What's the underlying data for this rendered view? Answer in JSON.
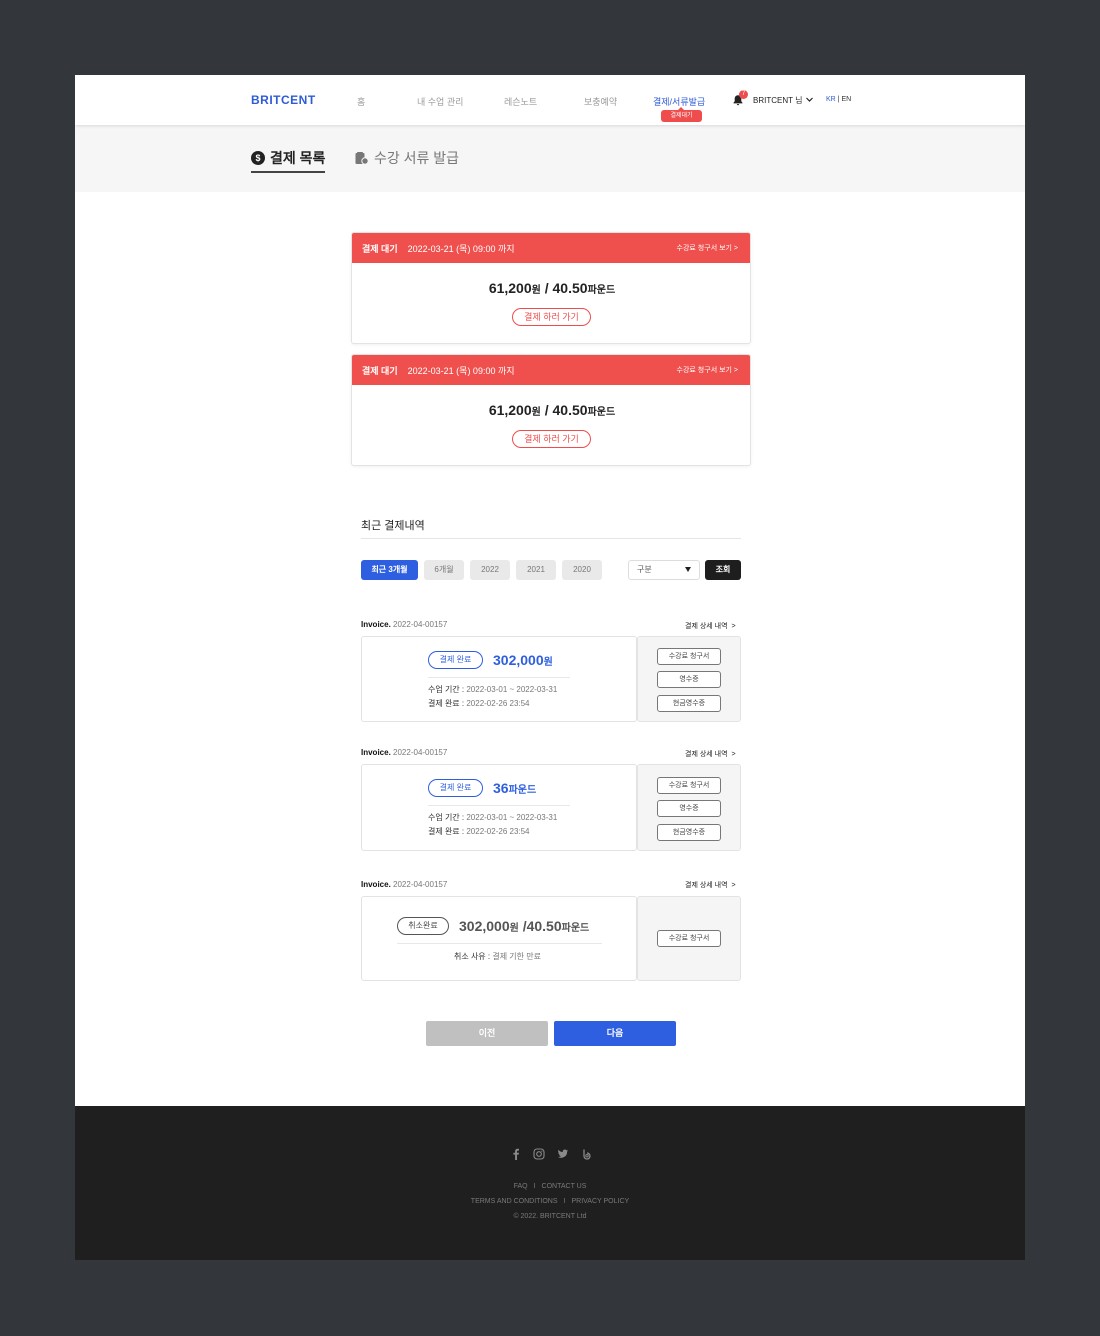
{
  "header": {
    "logo": "BRITCENT",
    "nav": [
      "홈",
      "내 수업 관리",
      "레슨노트",
      "보충예약",
      "결제/서류발급"
    ],
    "nav_badge": "결제대기",
    "notification_count": "7",
    "user": "BRITCENT 님",
    "lang_kr": "KR",
    "lang_sep": " | ",
    "lang_en": "EN"
  },
  "subnav": {
    "tab_payments": "결제 목록",
    "tab_documents": "수강 서류 발급"
  },
  "pending": [
    {
      "status": "결제 대기",
      "deadline": "2022-03-21 (목) 09:00 까지",
      "view": "수강료 청구서 보기 >",
      "amount_krw": "61,200",
      "unit_krw": "원",
      "slash": " / ",
      "amount_gbp": "40.50",
      "unit_gbp": "파운드",
      "button": "결제 하러 가기"
    },
    {
      "status": "결제 대기",
      "deadline": "2022-03-21 (목) 09:00 까지",
      "view": "수강료 청구서 보기 >",
      "amount_krw": "61,200",
      "unit_krw": "원",
      "slash": " / ",
      "amount_gbp": "40.50",
      "unit_gbp": "파운드",
      "button": "결제 하러 가기"
    }
  ],
  "recent": {
    "title": "최근 결제내역",
    "filters": [
      "최근 3개월",
      "6개월",
      "2022",
      "2021",
      "2020"
    ],
    "select_label": "구분",
    "search": "조회"
  },
  "invoices": [
    {
      "label": "Invoice.",
      "number": "2022-04-00157",
      "detail": "결제 상세 내역",
      "status": "결제 완료",
      "price": "302,000",
      "unit": "원",
      "period_label": "수업 기간 : ",
      "period": "2022-03-01 ~ 2022-03-31",
      "paid_label": "결제 완료 : ",
      "paid": "2022-02-26 23:54",
      "docs": [
        "수강료 청구서",
        "영수증",
        "현금영수증"
      ]
    },
    {
      "label": "Invoice.",
      "number": "2022-04-00157",
      "detail": "결제 상세 내역",
      "status": "결제 완료",
      "price": "36",
      "unit": "파운드",
      "period_label": "수업 기간 : ",
      "period": "2022-03-01 ~ 2022-03-31",
      "paid_label": "결제 완료 : ",
      "paid": "2022-02-26 23:54",
      "docs": [
        "수강료 청구서",
        "영수증",
        "현금영수증"
      ]
    },
    {
      "label": "Invoice.",
      "number": "2022-04-00157",
      "detail": "결제 상세 내역",
      "status": "취소완료",
      "price": "302,000",
      "unit": "원",
      "price2": " /40.50",
      "unit2": "파운드",
      "reason_label": "취소 사유 : ",
      "reason": "결제 기한 만료",
      "docs": [
        "수강료 청구서"
      ]
    }
  ],
  "pager": {
    "prev": "이전",
    "next": "다음"
  },
  "footer": {
    "social": [
      "facebook-icon",
      "instagram-icon",
      "twitter-icon",
      "blog-icon"
    ],
    "faq": "FAQ",
    "contact": "CONTACT US",
    "sep": "I",
    "terms": "TERMS AND CONDITIONS",
    "privacy": "PRIVACY POLICY",
    "copyright": "© 2022. BRITCENT Ltd"
  },
  "colors": {
    "accent": "#2e5fe0",
    "alert": "#f0504d",
    "footer_bg": "#1f1f1f",
    "page_bg": "#33363b"
  }
}
